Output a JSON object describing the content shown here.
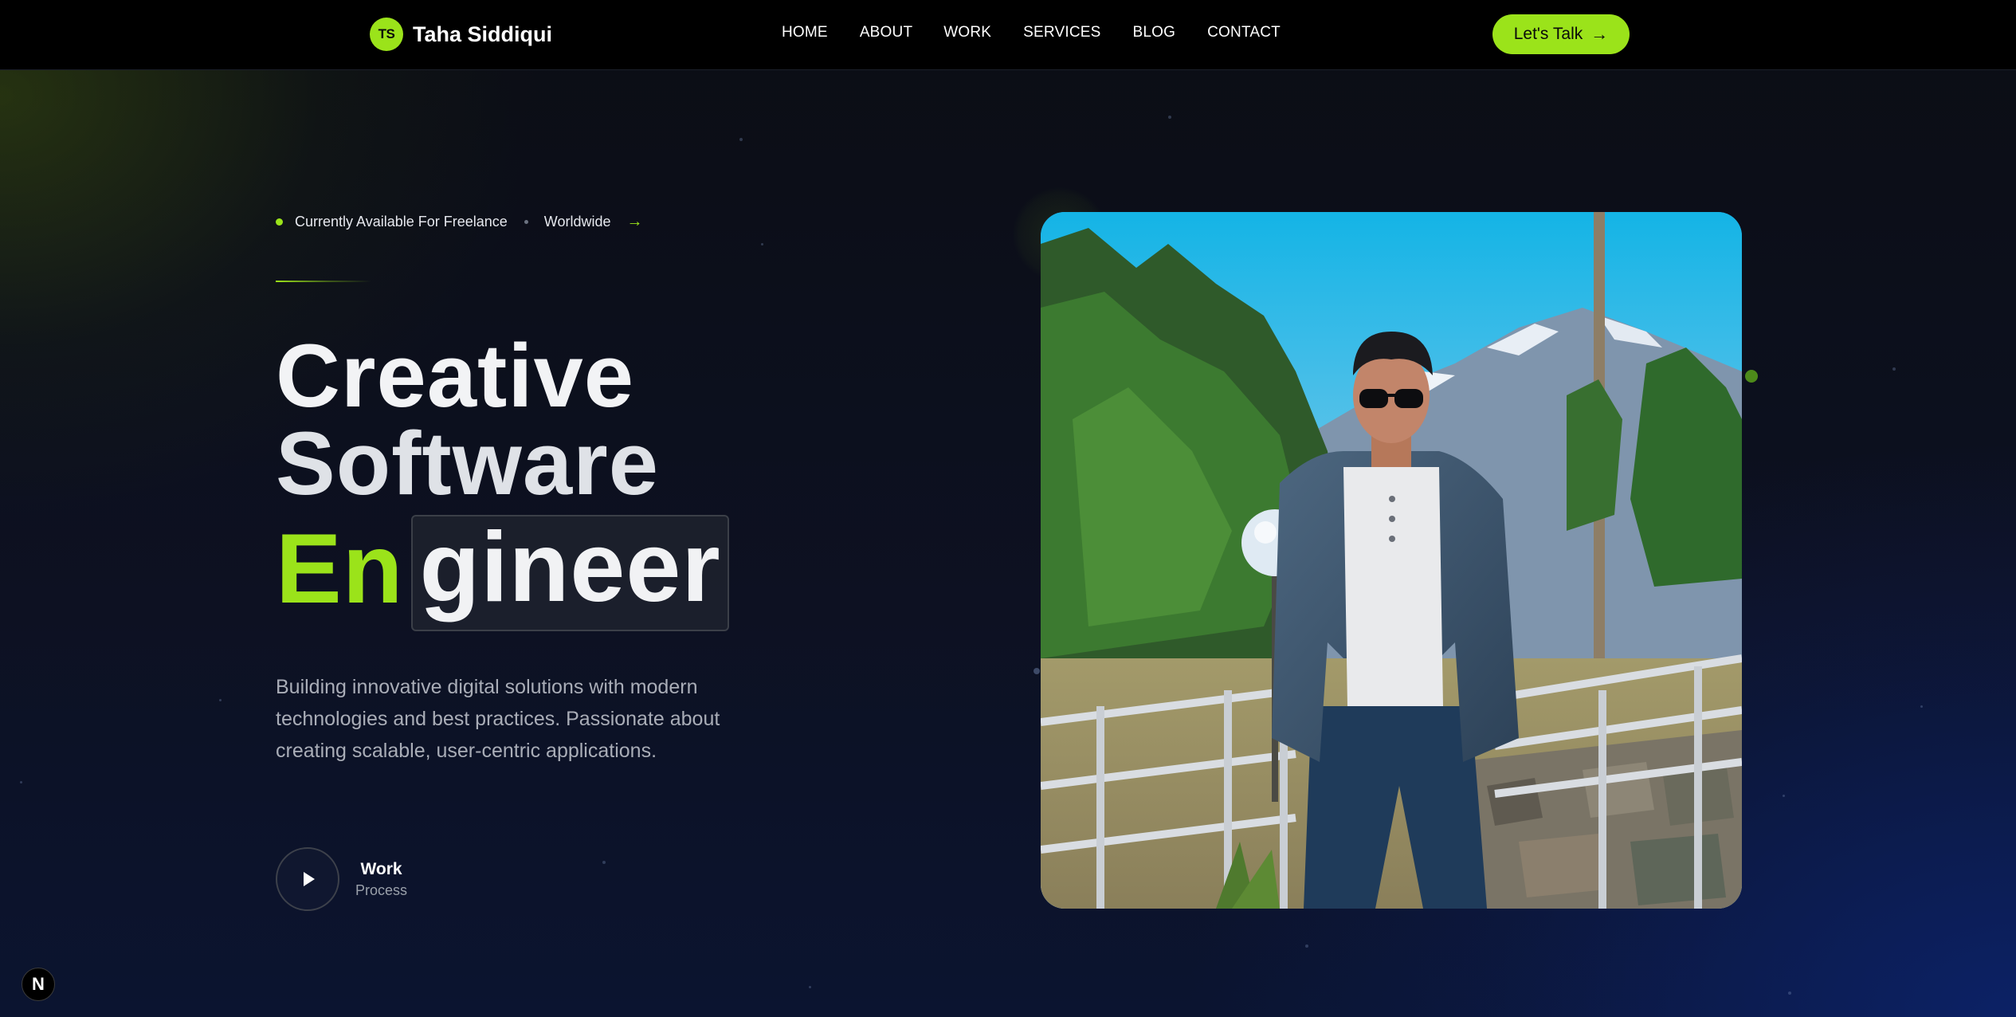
{
  "brand": {
    "initials": "TS",
    "name": "Taha Siddiqui",
    "accent_color": "#9be31a"
  },
  "nav": {
    "items": [
      {
        "label": "HOME"
      },
      {
        "label": "ABOUT"
      },
      {
        "label": "WORK"
      },
      {
        "label": "SERVICES"
      },
      {
        "label": "BLOG"
      },
      {
        "label": "CONTACT"
      }
    ],
    "cta_label": "Let's Talk",
    "cta_icon": "arrow-right-icon"
  },
  "hero": {
    "availability": {
      "status_text": "Currently Available For Freelance",
      "location_text": "Worldwide",
      "arrow_icon": "arrow-right-icon"
    },
    "headline": {
      "line1": "Creative",
      "line2": "Software",
      "line3_highlight": "En",
      "line3_rest": "gineer"
    },
    "description": "Building innovative digital solutions with modern technologies and best practices. Passionate about creating scalable, user-centric applications.",
    "play": {
      "icon": "play-icon",
      "title": "Work",
      "subtitle": "Process"
    },
    "photo": {
      "icon": "portrait-photo"
    }
  },
  "dev_badge": {
    "label": "N"
  }
}
